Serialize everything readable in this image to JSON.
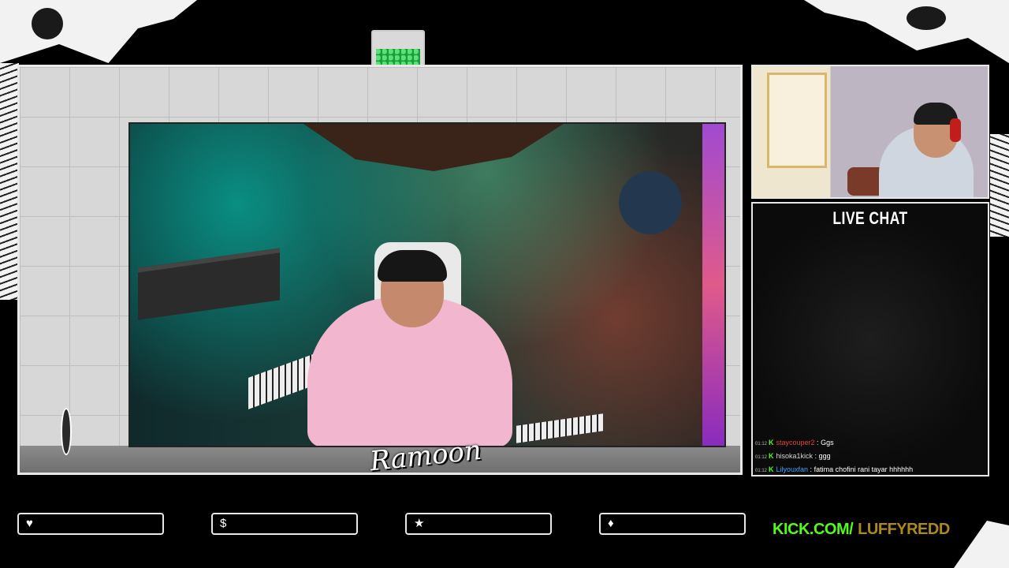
{
  "chat": {
    "title": "LIVE CHAT",
    "messages": [
      {
        "time": "01:12",
        "badge": "K",
        "user": "staycouper2",
        "user_color": "#e5403a",
        "text": "Ggs"
      },
      {
        "time": "01:12",
        "badge": "K",
        "user": "hisoka1kick",
        "user_color": "#d6d6d6",
        "text": "ggg"
      },
      {
        "time": "01:12",
        "badge": "K",
        "user": "Lilyouxfan",
        "user_color": "#3aa0ff",
        "text": "fatima chofini rani tayar hhhhhh"
      }
    ]
  },
  "stage": {
    "signature": "Ramoon"
  },
  "bars": [
    {
      "icon": "heart-icon",
      "glyph": "♥",
      "value": ""
    },
    {
      "icon": "dollar-icon",
      "glyph": "$",
      "value": ""
    },
    {
      "icon": "star-icon",
      "glyph": "★",
      "value": ""
    },
    {
      "icon": "diamond-icon",
      "glyph": "♦",
      "value": ""
    }
  ],
  "branding": {
    "domain": "KICK.COM/",
    "username": "LUFFYREDD"
  },
  "colors": {
    "kick_green": "#53fc18",
    "frame": "#e8e8e8"
  }
}
